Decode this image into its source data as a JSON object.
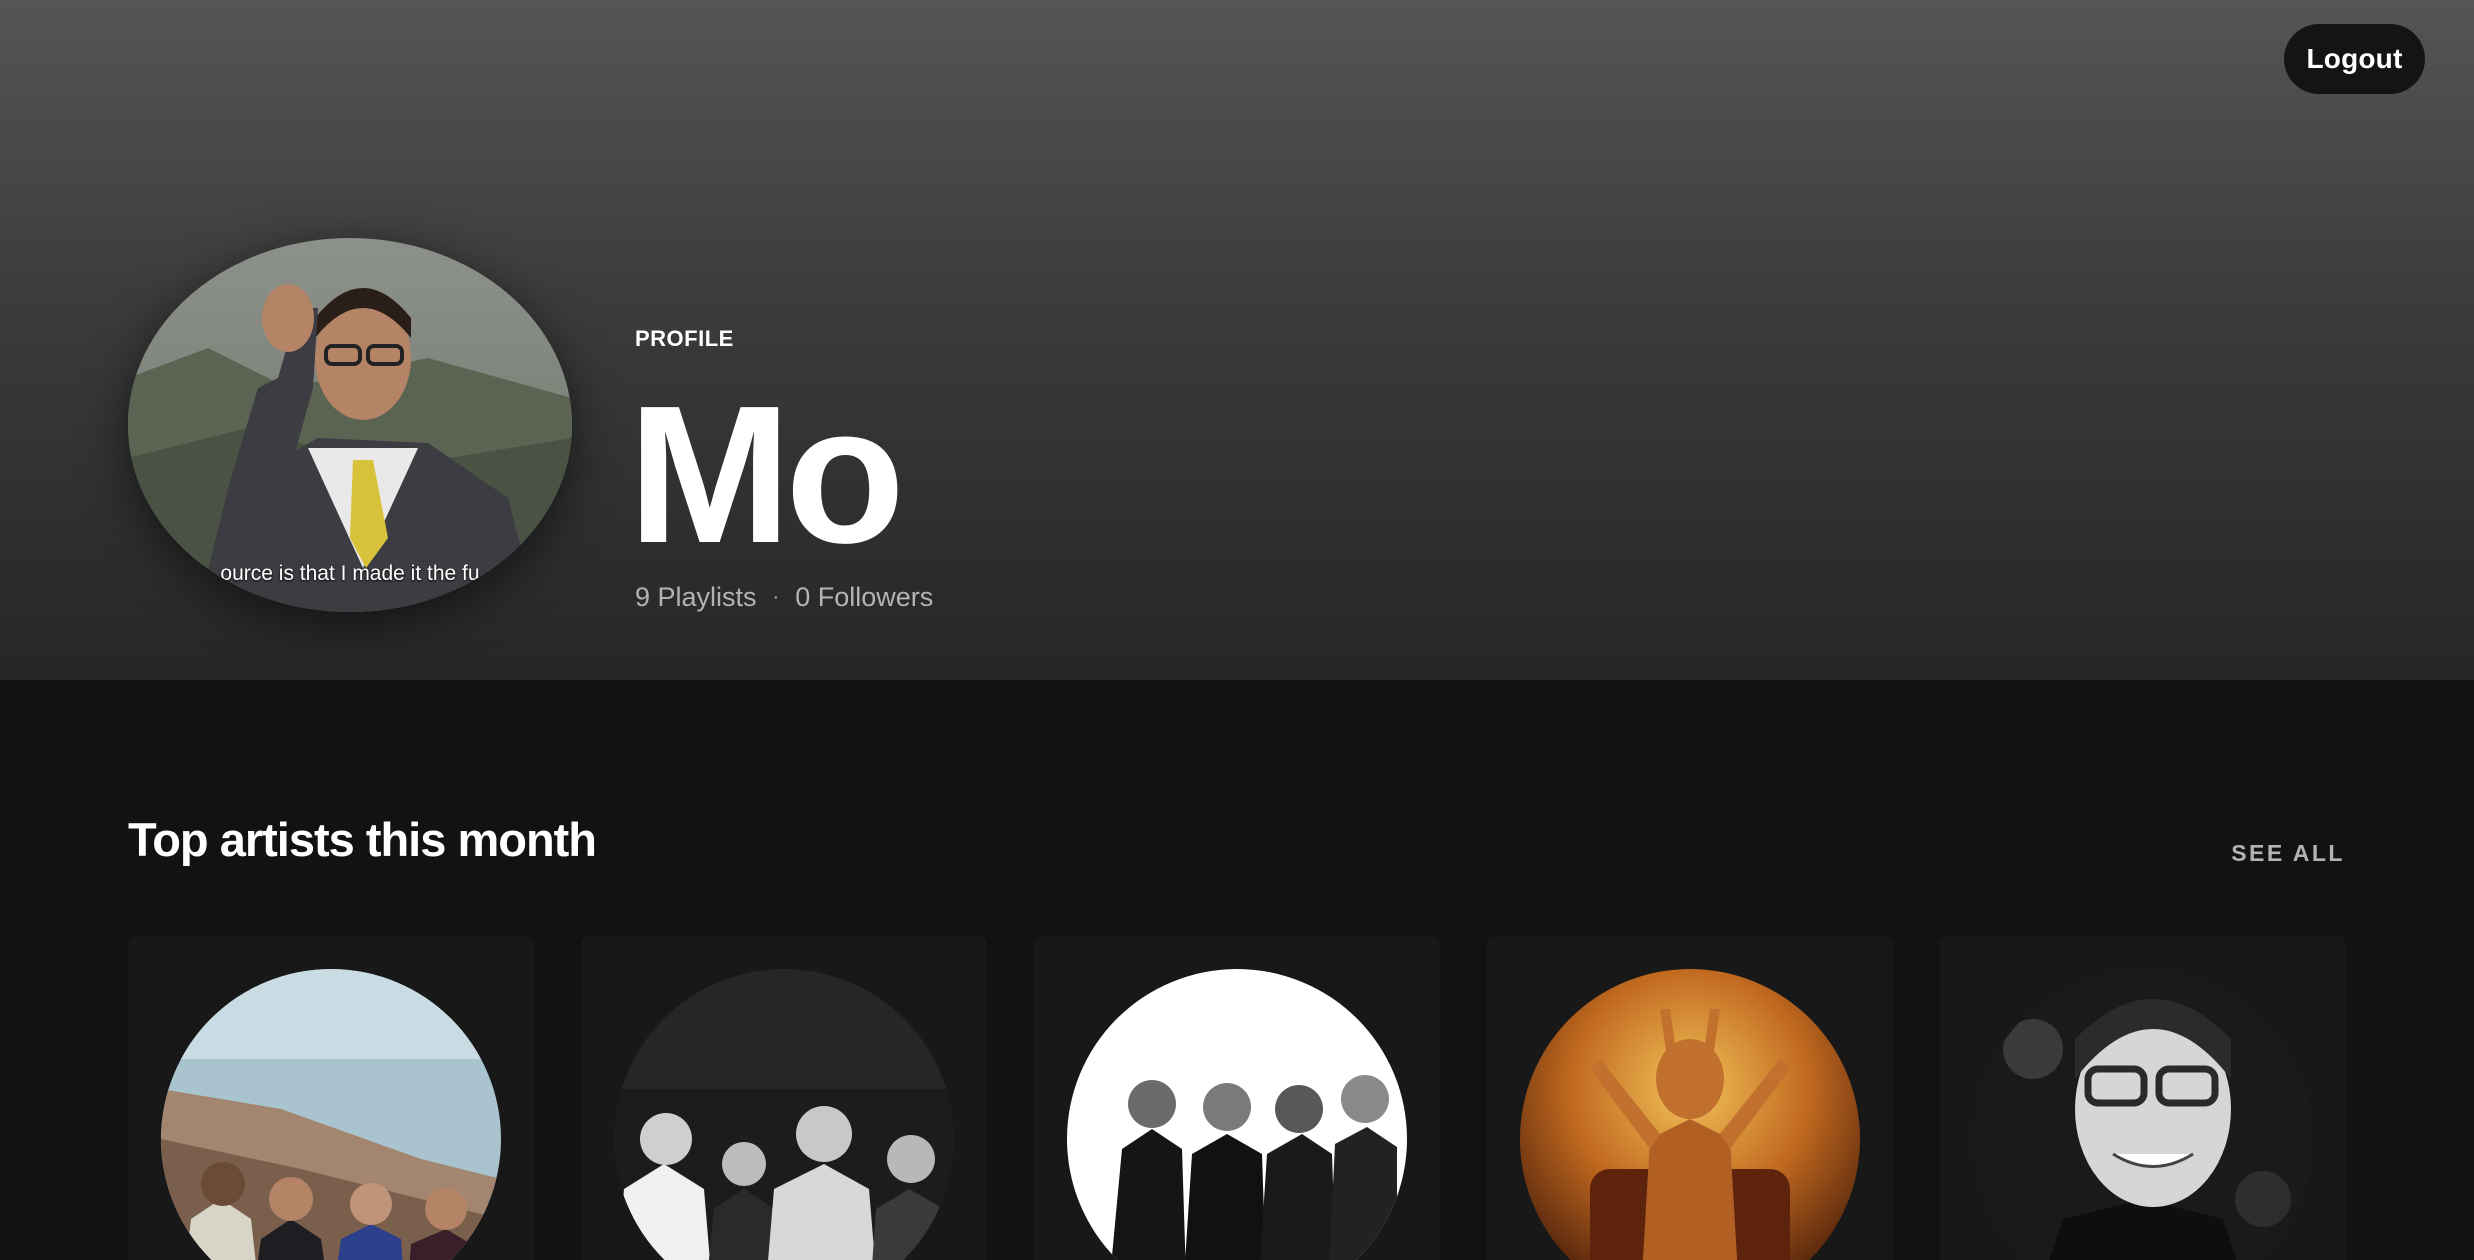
{
  "header": {
    "logout_label": "Logout"
  },
  "profile": {
    "label": "PROFILE",
    "name": "Mo",
    "playlists": "9 Playlists",
    "separator": "·",
    "followers": "0 Followers",
    "avatar_caption": "ource is that I made it the fu"
  },
  "top_artists": {
    "title": "Top artists this month",
    "see_all_label": "SEE ALL"
  },
  "colors": {
    "hero_top": "#555555",
    "hero_bottom": "#262626",
    "background": "#121212",
    "card": "#181818",
    "muted_text": "#b3b3b3"
  }
}
